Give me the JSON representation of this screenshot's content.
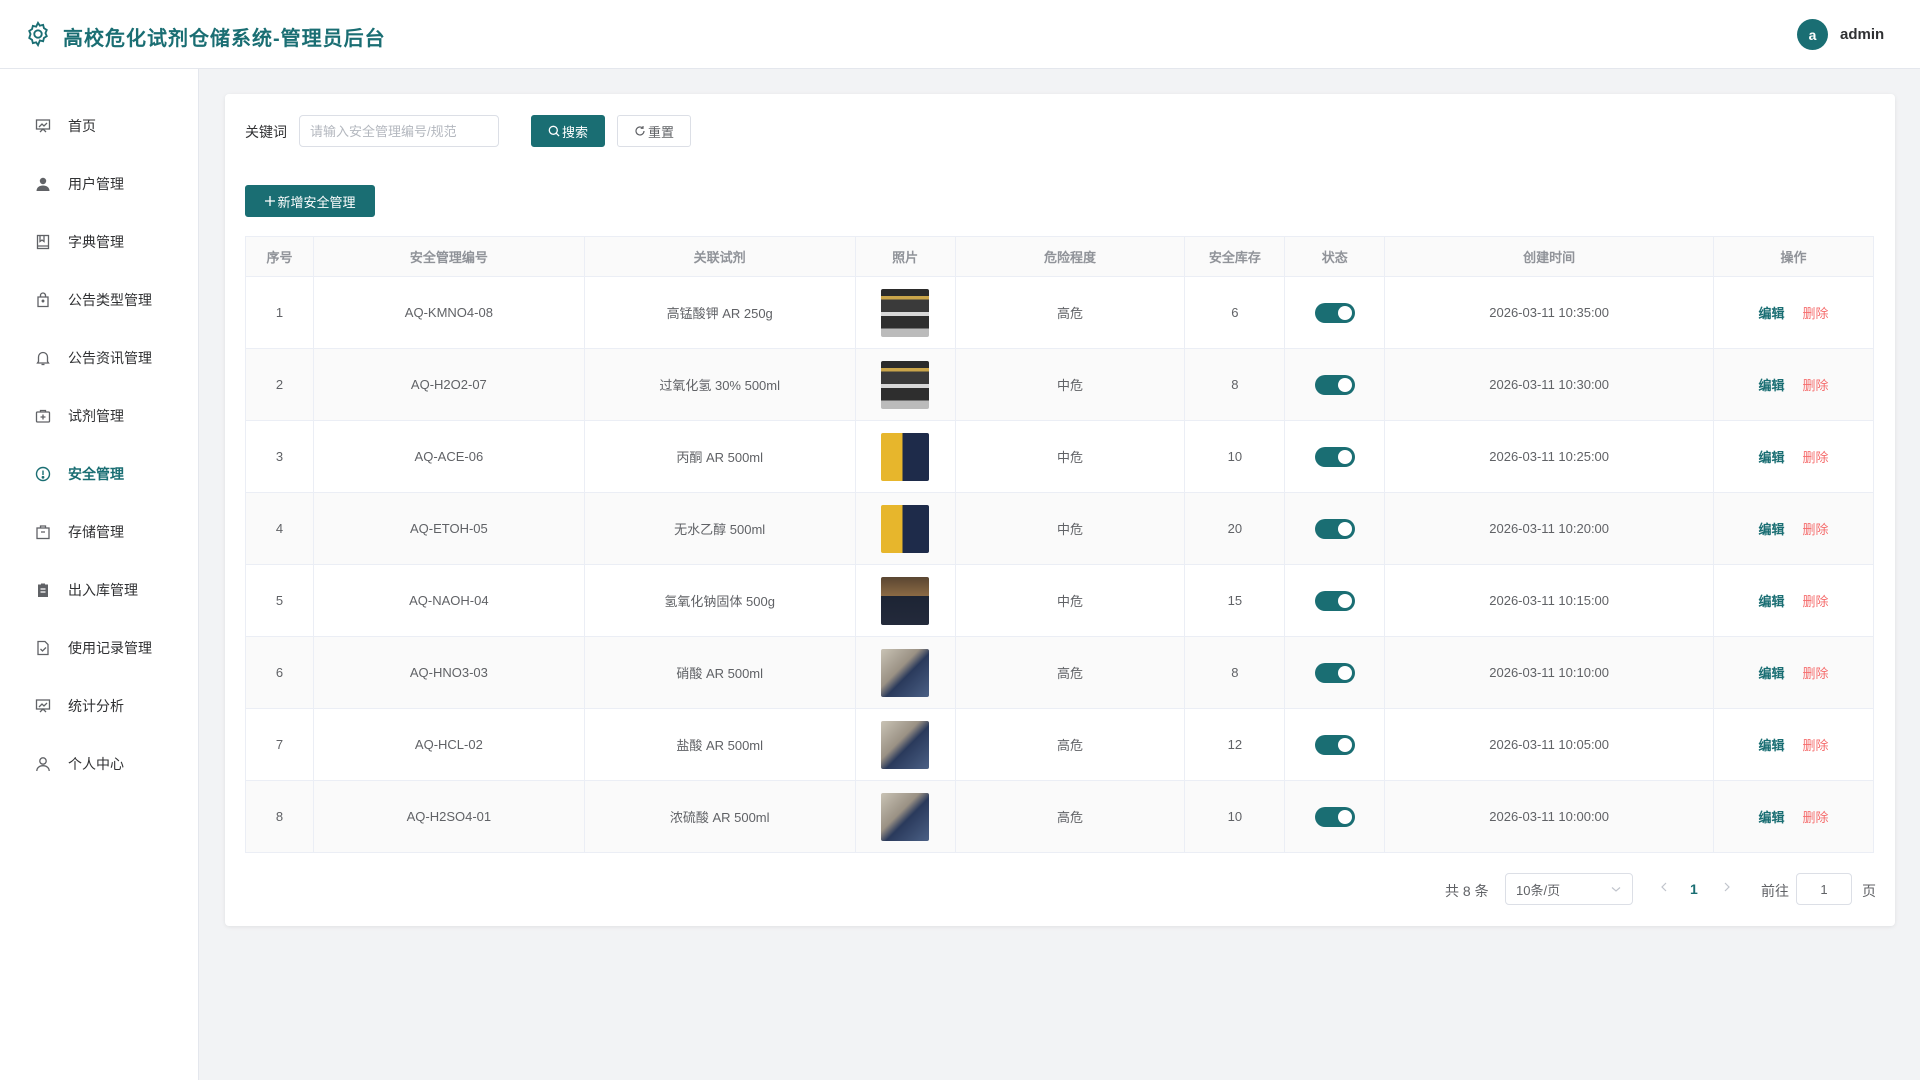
{
  "header": {
    "title": "高校危化试剂仓储系统-管理员后台",
    "avatar_letter": "a",
    "username": "admin"
  },
  "sidebar": {
    "items": [
      {
        "label": "首页",
        "icon": "dashboard-icon"
      },
      {
        "label": "用户管理",
        "icon": "user-icon"
      },
      {
        "label": "字典管理",
        "icon": "book-icon"
      },
      {
        "label": "公告类型管理",
        "icon": "bag-icon"
      },
      {
        "label": "公告资讯管理",
        "icon": "bell-icon"
      },
      {
        "label": "试剂管理",
        "icon": "first-aid-icon"
      },
      {
        "label": "安全管理",
        "icon": "warning-icon",
        "active": true
      },
      {
        "label": "存储管理",
        "icon": "box-icon"
      },
      {
        "label": "出入库管理",
        "icon": "clipboard-icon"
      },
      {
        "label": "使用记录管理",
        "icon": "document-check-icon"
      },
      {
        "label": "统计分析",
        "icon": "chart-icon"
      },
      {
        "label": "个人中心",
        "icon": "person-outline-icon"
      }
    ]
  },
  "search": {
    "label": "关键词",
    "placeholder": "请输入安全管理编号/规范",
    "search_label": "搜索",
    "reset_label": "重置"
  },
  "toolbar": {
    "add_label": "新增安全管理"
  },
  "table": {
    "columns": [
      "序号",
      "安全管理编号",
      "关联试剂",
      "照片",
      "危险程度",
      "安全库存",
      "状态",
      "创建时间",
      "操作"
    ],
    "edit_label": "编辑",
    "delete_label": "删除",
    "rows": [
      {
        "index": "1",
        "code": "AQ-KMNO4-08",
        "reagent": "高锰酸钾 AR 250g",
        "photo": "shelf",
        "level": "高危",
        "stock": "6",
        "status": true,
        "created": "2026-03-11 10:35:00"
      },
      {
        "index": "2",
        "code": "AQ-H2O2-07",
        "reagent": "过氧化氢 30% 500ml",
        "photo": "shelf",
        "level": "中危",
        "stock": "8",
        "status": true,
        "created": "2026-03-11 10:30:00"
      },
      {
        "index": "3",
        "code": "AQ-ACE-06",
        "reagent": "丙酮 AR 500ml",
        "photo": "lab-yellow",
        "level": "中危",
        "stock": "10",
        "status": true,
        "created": "2026-03-11 10:25:00"
      },
      {
        "index": "4",
        "code": "AQ-ETOH-05",
        "reagent": "无水乙醇 500ml",
        "photo": "lab-yellow",
        "level": "中危",
        "stock": "20",
        "status": true,
        "created": "2026-03-11 10:20:00"
      },
      {
        "index": "5",
        "code": "AQ-NAOH-04",
        "reagent": "氢氧化钠固体 500g",
        "photo": "lab-bench",
        "level": "中危",
        "stock": "15",
        "status": true,
        "created": "2026-03-11 10:15:00"
      },
      {
        "index": "6",
        "code": "AQ-HNO3-03",
        "reagent": "硝酸 AR 500ml",
        "photo": "lab-person",
        "level": "高危",
        "stock": "8",
        "status": true,
        "created": "2026-03-11 10:10:00"
      },
      {
        "index": "7",
        "code": "AQ-HCL-02",
        "reagent": "盐酸 AR 500ml",
        "photo": "lab-person",
        "level": "高危",
        "stock": "12",
        "status": true,
        "created": "2026-03-11 10:05:00"
      },
      {
        "index": "8",
        "code": "AQ-H2SO4-01",
        "reagent": "浓硫酸 AR 500ml",
        "photo": "lab-person",
        "level": "高危",
        "stock": "10",
        "status": true,
        "created": "2026-03-11 10:00:00"
      }
    ]
  },
  "pagination": {
    "total_text": "共 8 条",
    "page_size": "10条/页",
    "current_page": "1",
    "goto_label": "前往",
    "goto_value": "1",
    "page_suffix": "页"
  },
  "colors": {
    "accent": "#1a6e73",
    "danger": "#f56c6c"
  }
}
